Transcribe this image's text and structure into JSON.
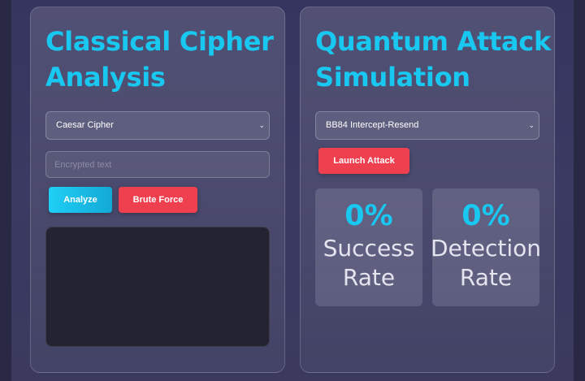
{
  "classical": {
    "title": "Classical Cipher Analysis",
    "cipher_select_value": "Caesar Cipher",
    "input_placeholder": "Encrypted text",
    "analyze_label": "Analyze",
    "brute_force_label": "Brute Force",
    "output_text": ""
  },
  "quantum": {
    "title": "Quantum Attack Simulation",
    "attack_select_value": "BB84 Intercept-Resend",
    "launch_label": "Launch Attack",
    "stats": {
      "success_value": "0%",
      "success_label": "Success\nRate",
      "detection_value": "0%",
      "detection_label": "Detection\nRate"
    }
  },
  "icons": {
    "dropdown": "chevron-down-icon",
    "dropdown_glyph": "⌄"
  }
}
